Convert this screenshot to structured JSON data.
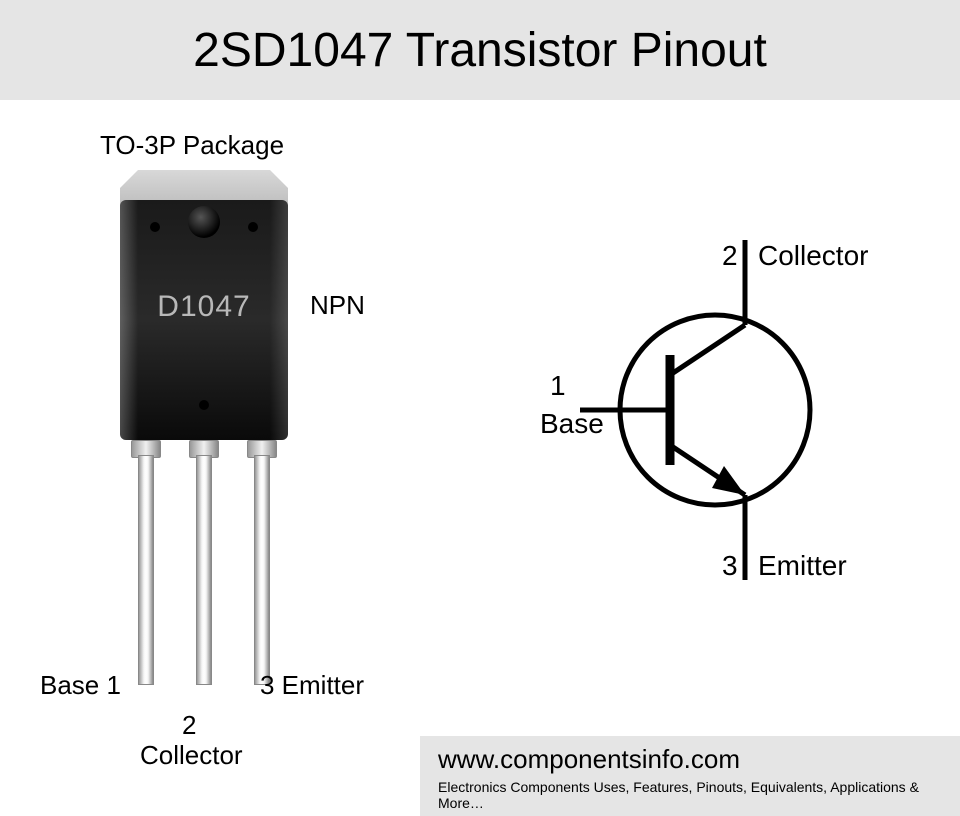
{
  "title": "2SD1047 Transistor Pinout",
  "package": {
    "label": "TO-3P Package",
    "type": "NPN",
    "marking": "D1047"
  },
  "pins": {
    "p1": {
      "num": "1",
      "name": "Base",
      "combo_left": "Base 1"
    },
    "p2": {
      "num": "2",
      "name": "Collector"
    },
    "p3": {
      "num": "3",
      "name": "Emitter",
      "combo_right": "3 Emitter"
    }
  },
  "schematic": {
    "collector": {
      "num": "2",
      "name": "Collector"
    },
    "base": {
      "num": "1",
      "name": "Base"
    },
    "emitter": {
      "num": "3",
      "name": "Emitter"
    }
  },
  "footer": {
    "url": "www.componentsinfo.com",
    "tagline": "Electronics Components Uses, Features, Pinouts, Equivalents, Applications & More…"
  }
}
